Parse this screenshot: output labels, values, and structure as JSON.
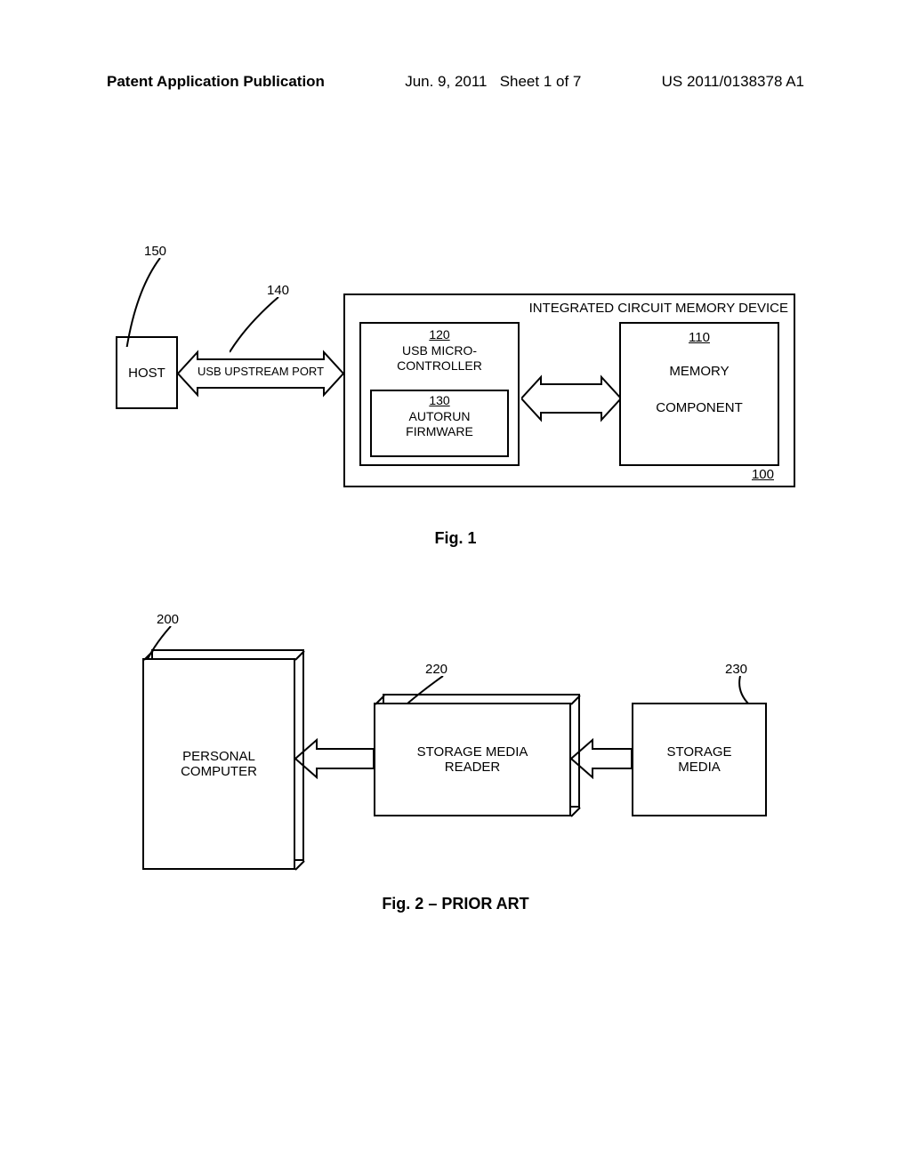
{
  "header": {
    "left": "Patent Application Publication",
    "date": "Jun. 9, 2011",
    "sheet": "Sheet 1 of 7",
    "pubno": "US 2011/0138378 A1"
  },
  "fig1": {
    "host": "HOST",
    "usb_upstream": "USB UPSTREAM PORT",
    "ic_title": "INTEGRATED CIRCUIT MEMORY DEVICE",
    "usb_micro_ref": "120",
    "usb_micro_l1": "USB MICRO-",
    "usb_micro_l2": "CONTROLLER",
    "autorun_ref": "130",
    "autorun_l1": "AUTORUN",
    "autorun_l2": "FIRMWARE",
    "mem_ref": "110",
    "mem_l1": "MEMORY",
    "mem_l2": "COMPONENT",
    "ref100": "100",
    "ref150": "150",
    "ref140": "140",
    "caption": "Fig. 1"
  },
  "fig2": {
    "pc_l1": "PERSONAL",
    "pc_l2": "COMPUTER",
    "reader_l1": "STORAGE MEDIA",
    "reader_l2": "READER",
    "media_l1": "STORAGE",
    "media_l2": "MEDIA",
    "ref200": "200",
    "ref220": "220",
    "ref230": "230",
    "caption": "Fig. 2 – PRIOR ART"
  }
}
